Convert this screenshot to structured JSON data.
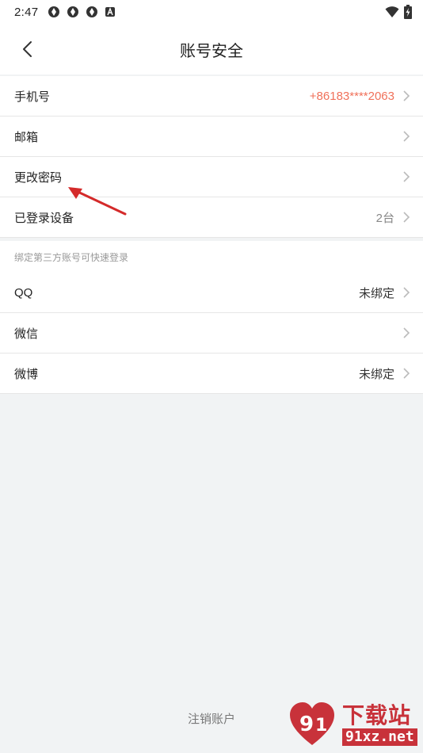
{
  "status_bar": {
    "time": "2:47",
    "left_icons": [
      "aperture-icon",
      "aperture-icon",
      "aperture-icon",
      "app-badge-icon"
    ],
    "right_icons": [
      "wifi-icon",
      "battery-charging-icon"
    ]
  },
  "header": {
    "title": "账号安全",
    "back_icon": "chevron-left-icon"
  },
  "account_section": {
    "rows": [
      {
        "label": "手机号",
        "value": "+86183****2063"
      },
      {
        "label": "邮箱",
        "value": ""
      },
      {
        "label": "更改密码",
        "value": ""
      },
      {
        "label": "已登录设备",
        "value": "2台"
      }
    ]
  },
  "third_party_section": {
    "header": "绑定第三方账号可快速登录",
    "rows": [
      {
        "label": "QQ",
        "value": "未绑定"
      },
      {
        "label": "微信",
        "value": ""
      },
      {
        "label": "微博",
        "value": "未绑定"
      }
    ]
  },
  "footer": {
    "logout_label": "注销账户"
  },
  "watermark": {
    "cn": "下载站",
    "en": "91xz.net"
  },
  "colors": {
    "accent": "#f0715a",
    "annotation_arrow": "#d42a2a",
    "watermark": "#c8323a"
  }
}
